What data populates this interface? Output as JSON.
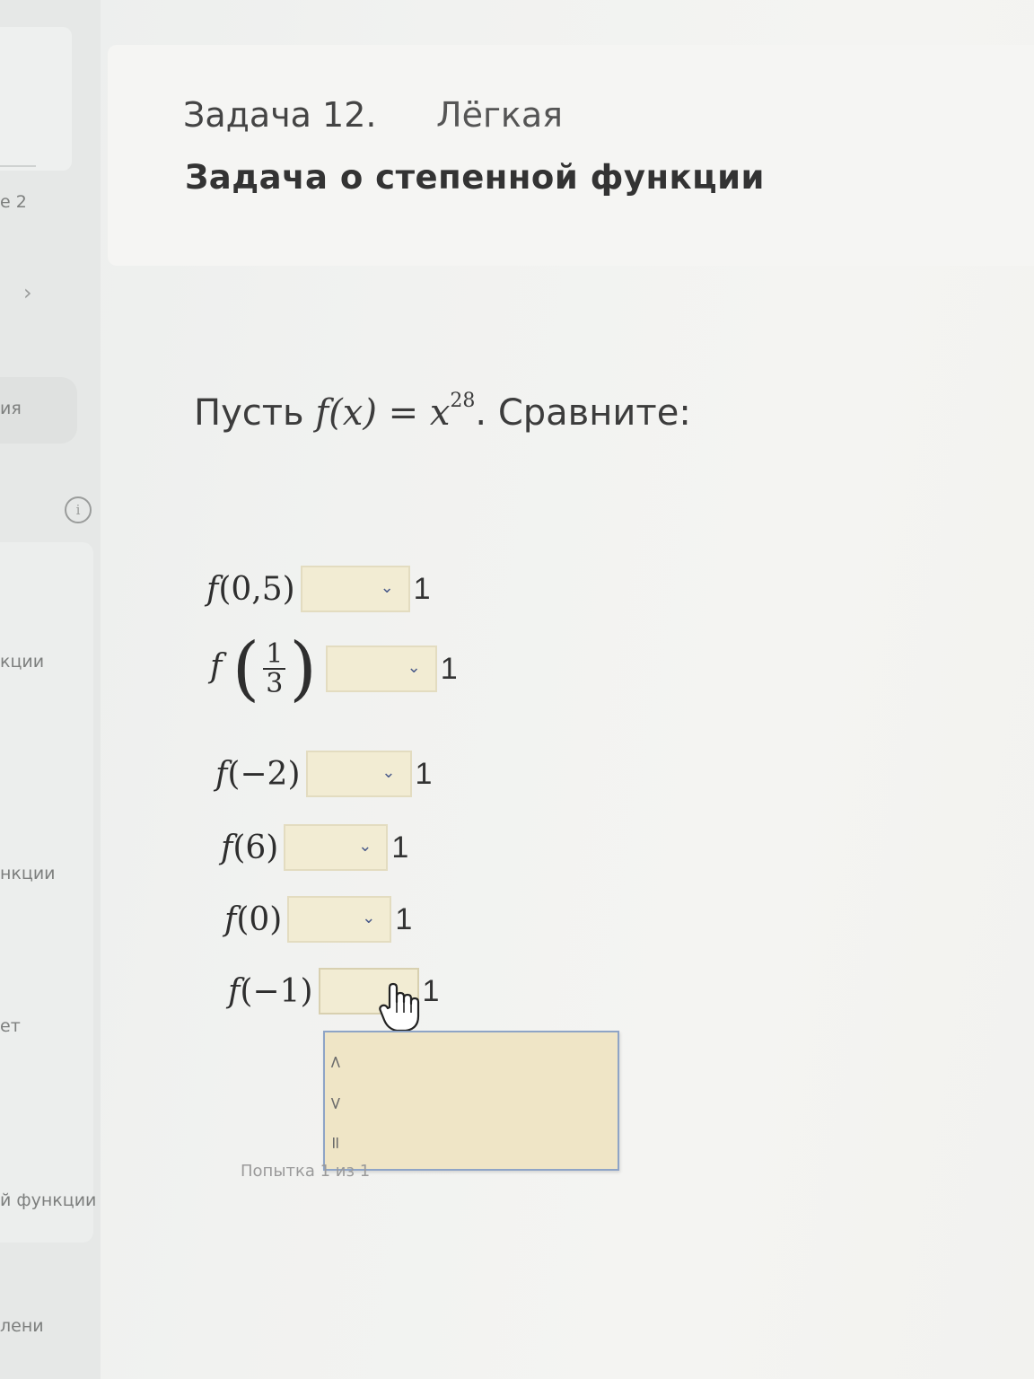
{
  "sidebar": {
    "items": [
      {
        "label": "е 2"
      },
      {
        "label": "ия"
      },
      {
        "label": "кции"
      },
      {
        "label": "нкции"
      },
      {
        "label": "ет"
      },
      {
        "label": "й функции"
      },
      {
        "label": "лени"
      }
    ],
    "chevron": "›",
    "info": "i"
  },
  "header": {
    "task_number": "Задача 12.",
    "difficulty": "Лёгкая",
    "title": "Задача о степенной функции"
  },
  "statement": {
    "prefix": "Пусть ",
    "lhs": "f(x) = x",
    "exponent": "28",
    "suffix": ". Сравните:"
  },
  "rows": [
    {
      "fn": "f",
      "arg": "(0,5)",
      "rhs": "1"
    },
    {
      "fn": "f",
      "arg_num": "1",
      "arg_den": "3",
      "rhs": "1"
    },
    {
      "fn": "f",
      "arg": "(−2)",
      "rhs": "1"
    },
    {
      "fn": "f",
      "arg": "(6)",
      "rhs": "1"
    },
    {
      "fn": "f",
      "arg": "(0)",
      "rhs": "1"
    },
    {
      "fn": "f",
      "arg": "(−1)",
      "rhs": "1"
    }
  ],
  "dropdown": {
    "chevron": "⌄",
    "options": [
      "<",
      ">",
      "="
    ]
  },
  "attempt_text": "Попытка 1 из 1"
}
